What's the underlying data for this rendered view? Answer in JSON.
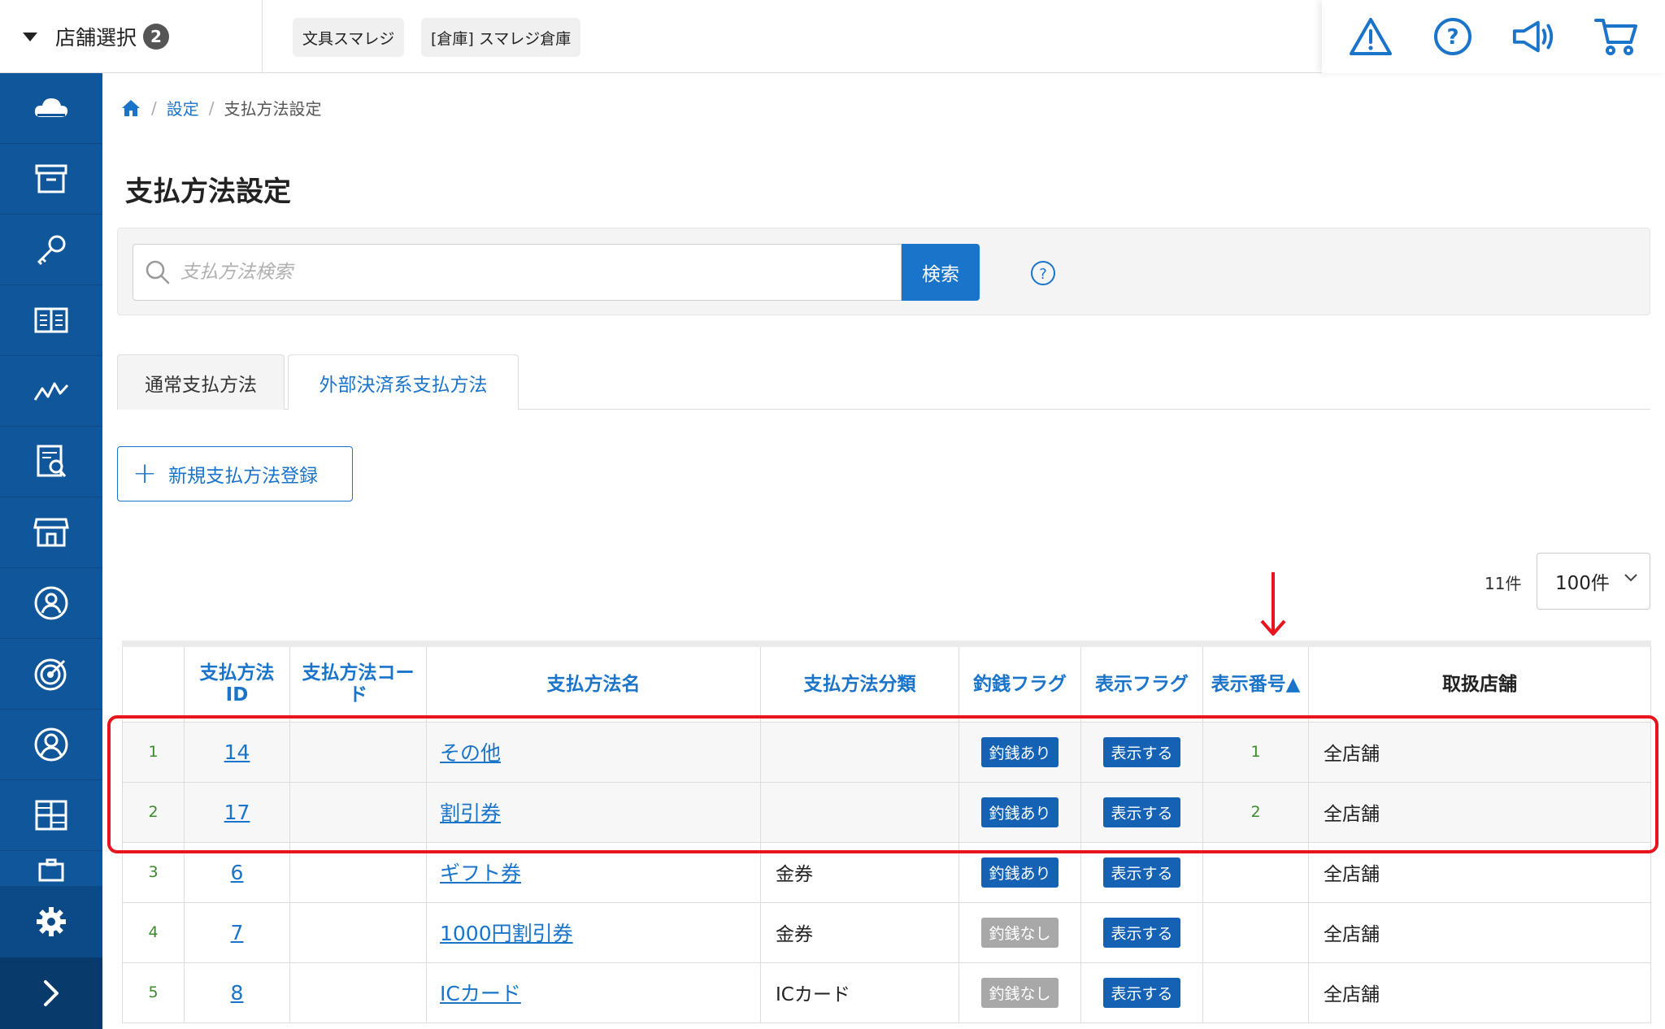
{
  "header": {
    "store_select_label": "店舗選択",
    "store_count": "2",
    "store_chips": [
      "文具スマレジ",
      "[倉庫] スマレジ倉庫"
    ],
    "icons": [
      "warning-icon",
      "help-icon",
      "megaphone-icon",
      "cart-icon"
    ]
  },
  "sidebar": {
    "items": [
      "cloud-icon",
      "archive-box-icon",
      "key-icon",
      "book-icon",
      "analytics-icon",
      "report-icon",
      "store-icon",
      "staff-icon",
      "target-icon",
      "customer-icon",
      "apps-icon",
      "briefcase-icon"
    ],
    "bottom": [
      "gear-icon",
      "chevron-right-icon"
    ]
  },
  "breadcrumb": {
    "home_icon": "home-icon",
    "settings": "設定",
    "current": "支払方法設定",
    "sep": "/"
  },
  "page": {
    "title": "支払方法設定"
  },
  "search": {
    "placeholder": "支払方法検索",
    "button": "検索",
    "help": "?"
  },
  "tabs": [
    {
      "label": "通常支払方法",
      "active": true
    },
    {
      "label": "外部決済系支払方法",
      "active": false
    }
  ],
  "actions": {
    "new_button": "新規支払方法登録"
  },
  "pagination": {
    "total": "11件",
    "per_page": "100件"
  },
  "table": {
    "headers": {
      "no": "",
      "id": "支払方法\nID",
      "code": "支払方法コー\nド",
      "name": "支払方法名",
      "category": "支払方法分類",
      "change_flag": "釣銭フラグ",
      "display_flag": "表示フラグ",
      "display_order": "表示番号▲",
      "stores": "取扱店舗"
    },
    "rows": [
      {
        "no": "1",
        "id": "14",
        "code": "",
        "name": "その他",
        "category": "",
        "change_flag": "釣銭あり",
        "change_on": true,
        "display_flag": "表示する",
        "display_order": "1",
        "stores": "全店舗"
      },
      {
        "no": "2",
        "id": "17",
        "code": "",
        "name": "割引券",
        "category": "",
        "change_flag": "釣銭あり",
        "change_on": true,
        "display_flag": "表示する",
        "display_order": "2",
        "stores": "全店舗"
      },
      {
        "no": "3",
        "id": "6",
        "code": "",
        "name": "ギフト券",
        "category": "金券",
        "change_flag": "釣銭あり",
        "change_on": true,
        "display_flag": "表示する",
        "display_order": "",
        "stores": "全店舗"
      },
      {
        "no": "4",
        "id": "7",
        "code": "",
        "name": "1000円割引券",
        "category": "金券",
        "change_flag": "釣銭なし",
        "change_on": false,
        "display_flag": "表示する",
        "display_order": "",
        "stores": "全店舗"
      },
      {
        "no": "5",
        "id": "8",
        "code": "",
        "name": "ICカード",
        "category": "ICカード",
        "change_flag": "釣銭なし",
        "change_on": false,
        "display_flag": "表示する",
        "display_order": "",
        "stores": "全店舗"
      }
    ]
  },
  "colors": {
    "brand_blue": "#1a74c9",
    "sidebar_blue": "#10569a",
    "annotation_red": "#e8141e",
    "row_number_green": "#3d8a2d"
  }
}
